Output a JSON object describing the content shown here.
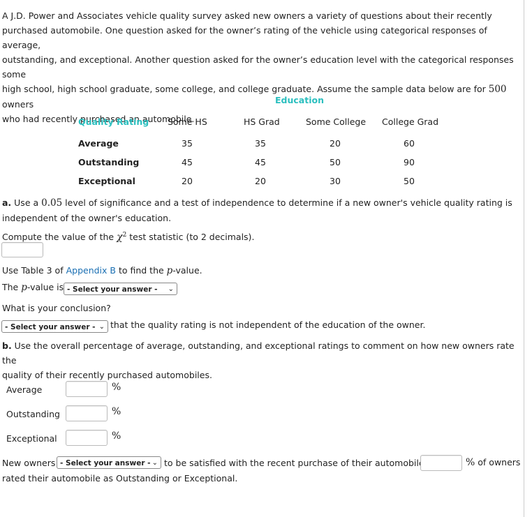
{
  "intro": {
    "line1": "A J.D. Power and Associates vehicle quality survey asked new owners a variety of questions about their recently",
    "line2": "purchased automobile. One question asked for the owner’s rating of the vehicle using categorical responses of average,",
    "line3": "outstanding, and exceptional. Another question asked for the owner’s education level with the categorical responses some",
    "line4a": "high school, high school graduate, some college, and college graduate. Assume the sample data below are for ",
    "line4n": "500",
    "line4b": " owners",
    "line5": "who had recently purchased an automobile."
  },
  "table": {
    "group_header": "Education",
    "row_header": "Quality Rating",
    "columns": [
      "Some HS",
      "HS Grad",
      "Some College",
      "College Grad"
    ],
    "rows": [
      {
        "label": "Average",
        "values": [
          "35",
          "35",
          "20",
          "60"
        ]
      },
      {
        "label": "Outstanding",
        "values": [
          "45",
          "45",
          "50",
          "90"
        ]
      },
      {
        "label": "Exceptional",
        "values": [
          "20",
          "20",
          "30",
          "50"
        ]
      }
    ]
  },
  "part_a": {
    "prefix": "a.",
    "text1": " Use a ",
    "alpha": "0.05",
    "text2": " level of significance and a test of independence to determine if a new owner's vehicle quality rating is",
    "text3": "independent of the owner's education.",
    "compute_pre": "Compute the value of the ",
    "chi": "χ",
    "chi_sup": "2",
    "compute_post": " test statistic (to 2 decimals).",
    "chi_input_value": "",
    "table_pre": "Use Table 3 of ",
    "appendix_link": "Appendix B",
    "table_post": " to find the ",
    "p": "p",
    "table_end": "-value.",
    "pvalue_pre": "The ",
    "pvalue_post": "-value is",
    "pvalue_select": "- Select your answer -",
    "conclusion_q": "What is your conclusion?",
    "conclusion_select": "- Select your answer -",
    "conclusion_post": "that the quality rating is not independent of the education of the owner."
  },
  "part_b": {
    "prefix": "b.",
    "text1": " Use the overall percentage of average, outstanding, and exceptional ratings to comment on how new owners rate the",
    "text2": "quality of their recently purchased automobiles.",
    "fields": [
      {
        "label": "Average",
        "value": "",
        "unit": "%"
      },
      {
        "label": "Outstanding",
        "value": "",
        "unit": "%"
      },
      {
        "label": "Exceptional",
        "value": "",
        "unit": "%"
      }
    ],
    "new_owners": "New owners",
    "satisfied_select": "- Select your answer -",
    "satisfied_post": "to be satisfied with the recent purchase of their automobile.",
    "pct_input_value": "",
    "pct_unit": "%",
    "pct_post": " of owners",
    "last_line": "rated their automobile as Outstanding or Exceptional."
  }
}
